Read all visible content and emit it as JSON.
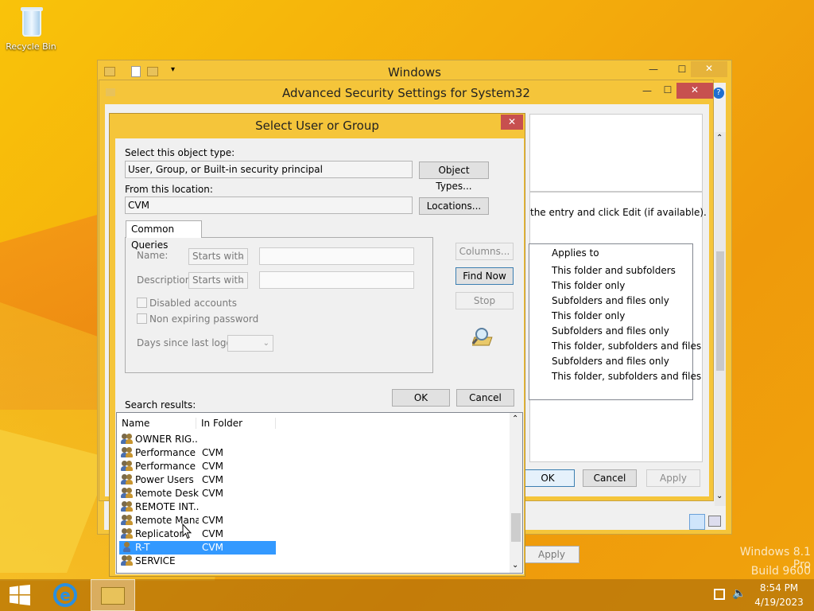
{
  "desktop": {
    "recycle_bin": "Recycle Bin",
    "watermark_line1": "Windows 8.1 Pro",
    "watermark_line2": "Build 9600"
  },
  "explorer": {
    "title": "Windows",
    "qat_sep": "|"
  },
  "adv": {
    "title": "Advanced Security Settings for System32",
    "hint": "the entry and click Edit (if available).",
    "applies_header": "Applies to",
    "applies": [
      "This folder and subfolders",
      "This folder only",
      "Subfolders and files only",
      "This folder only",
      "Subfolders and files only",
      "This folder, subfolders and files",
      "Subfolders and files only",
      "This folder, subfolders and files"
    ],
    "ok": "OK",
    "cancel": "Cancel",
    "apply": "Apply",
    "apply2": "Apply"
  },
  "dlg": {
    "title": "Select User or Group",
    "close": "✕",
    "object_type_label": "Select this object type:",
    "object_type_value": "User, Group, or Built-in security principal",
    "object_types_btn": "Object Types...",
    "location_label": "From this location:",
    "location_value": "CVM",
    "locations_btn": "Locations...",
    "tab": "Common Queries",
    "name_label": "Name:",
    "desc_label": "Description:",
    "starts_with": "Starts with",
    "disabled_accounts": "Disabled accounts",
    "non_expiring": "Non expiring password",
    "days_since": "Days since last logon:",
    "columns_btn": "Columns...",
    "find_now_btn": "Find Now",
    "stop_btn": "Stop",
    "ok": "OK",
    "cancel": "Cancel",
    "search_results": "Search results:",
    "col_name": "Name",
    "col_folder": "In Folder",
    "rows": [
      {
        "name": "OWNER RIG...",
        "folder": ""
      },
      {
        "name": "Performance ...",
        "folder": "CVM"
      },
      {
        "name": "Performance ...",
        "folder": "CVM"
      },
      {
        "name": "Power Users",
        "folder": "CVM"
      },
      {
        "name": "Remote Desk...",
        "folder": "CVM"
      },
      {
        "name": "REMOTE INT...",
        "folder": ""
      },
      {
        "name": "Remote Mana...",
        "folder": "CVM"
      },
      {
        "name": "Replicator",
        "folder": "CVM"
      },
      {
        "name": "R-T",
        "folder": "CVM"
      },
      {
        "name": "SERVICE",
        "folder": ""
      }
    ]
  },
  "taskbar": {
    "time": "8:54 PM",
    "date": "4/19/2023"
  },
  "colors": {
    "accent": "#f5c53a",
    "selection": "#3399ff",
    "close": "#c7504f"
  }
}
